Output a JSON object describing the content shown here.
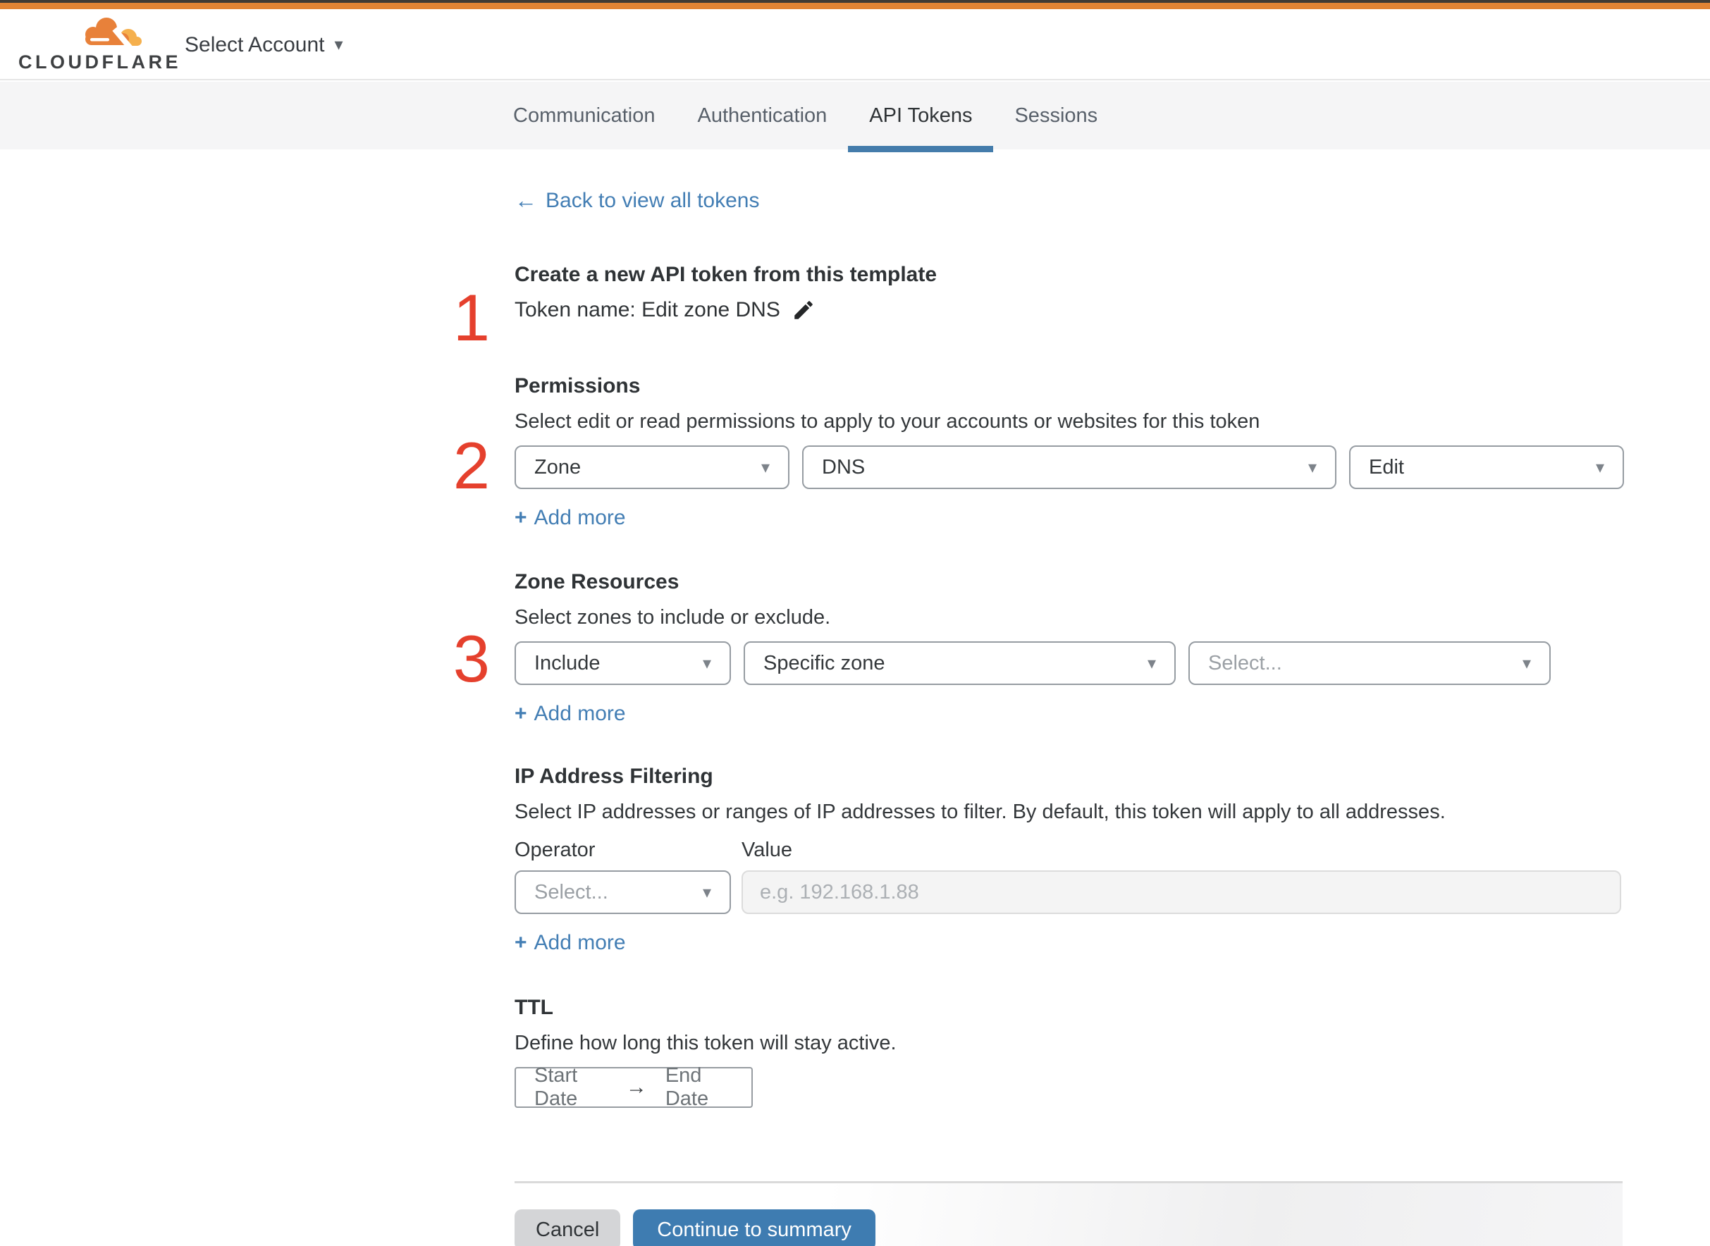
{
  "header": {
    "wordmark": "CLOUDFLARE",
    "account_selector": "Select Account"
  },
  "icons": {
    "caret": "▾",
    "plus": "+",
    "back_arrow": "←",
    "range_arrow": "→"
  },
  "tabs": [
    {
      "label": "Communication",
      "active": false
    },
    {
      "label": "Authentication",
      "active": false
    },
    {
      "label": "API Tokens",
      "active": true
    },
    {
      "label": "Sessions",
      "active": false
    }
  ],
  "back_link": "Back to view all tokens",
  "steps": [
    "1",
    "2",
    "3"
  ],
  "create_section": {
    "title": "Create a new API token from this template",
    "token_name": "Token name: Edit zone DNS"
  },
  "permissions": {
    "title": "Permissions",
    "description": "Select edit or read permissions to apply to your accounts or websites for this token",
    "dropdowns": [
      "Zone",
      "DNS",
      "Edit"
    ],
    "add_more": "Add more"
  },
  "zone_resources": {
    "title": "Zone Resources",
    "description": "Select zones to include or exclude.",
    "dropdowns": [
      "Include",
      "Specific zone",
      "Select..."
    ],
    "add_more": "Add more"
  },
  "ip_filtering": {
    "title": "IP Address Filtering",
    "description": "Select IP addresses or ranges of IP addresses to filter. By default, this token will apply to all addresses.",
    "operator_label": "Operator",
    "value_label": "Value",
    "operator_value": "Select...",
    "value_placeholder": "e.g. 192.168.1.88",
    "add_more": "Add more"
  },
  "ttl": {
    "title": "TTL",
    "description": "Define how long this token will stay active.",
    "start_label": "Start Date",
    "end_label": "End Date"
  },
  "footer": {
    "cancel_label": "Cancel",
    "continue_label": "Continue to summary"
  },
  "colors": {
    "accent_orange": "#e08435",
    "logo_orange": "#e8813a",
    "logo_light_orange": "#f5b04d",
    "step_number_red": "#e5402d",
    "link_blue": "#437eb4",
    "tab_underline_blue": "#447cab",
    "primary_button_blue": "#3e7cb1",
    "tab_bar_bg": "#f5f5f6"
  }
}
